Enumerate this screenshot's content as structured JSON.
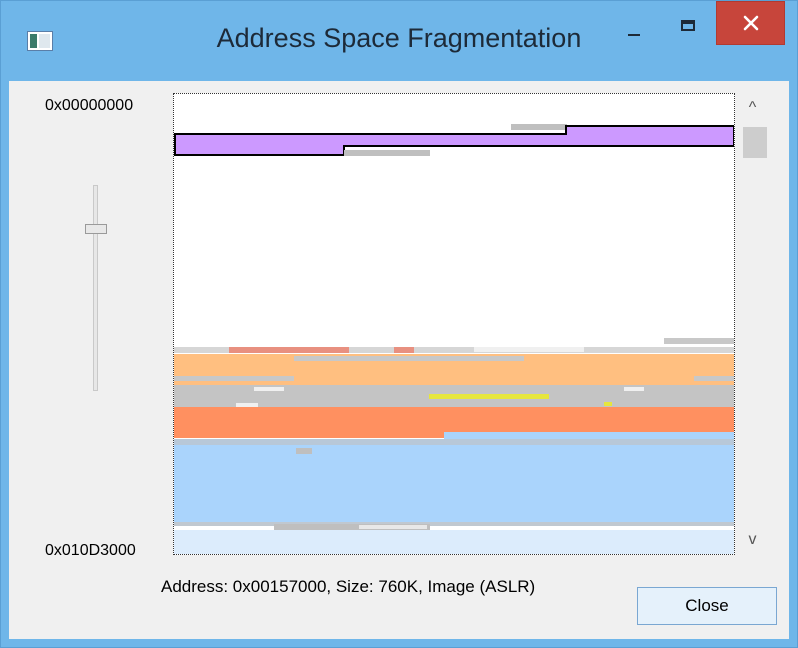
{
  "window": {
    "title": "Address Space Fragmentation",
    "icon": "app-window-icon",
    "controls": [
      "minimize-icon",
      "maximize-icon",
      "close-icon"
    ]
  },
  "address_range": {
    "start": "0x00000000",
    "end": "0x010D3000"
  },
  "zoom_slider": {
    "level_fraction": 0.2
  },
  "scrollbar": {
    "up_glyph": "^",
    "down_glyph": "v",
    "position_fraction": 0.05
  },
  "status": {
    "text": "Address: 0x00157000, Size: 760K, Image (ASLR)"
  },
  "buttons": {
    "close_label": "Close"
  },
  "legend_colors": {
    "selected_image_aslr": "#cc99ff",
    "free": "#ffffff",
    "reserved_gray": "#c0c0c0",
    "heap_peach": "#ffbf80",
    "private_orange": "#ff9060",
    "mapped_blue": "#aad4fc",
    "highlight_yellow": "#e6e63c",
    "bottom_light_blue": "#dcecfc"
  }
}
